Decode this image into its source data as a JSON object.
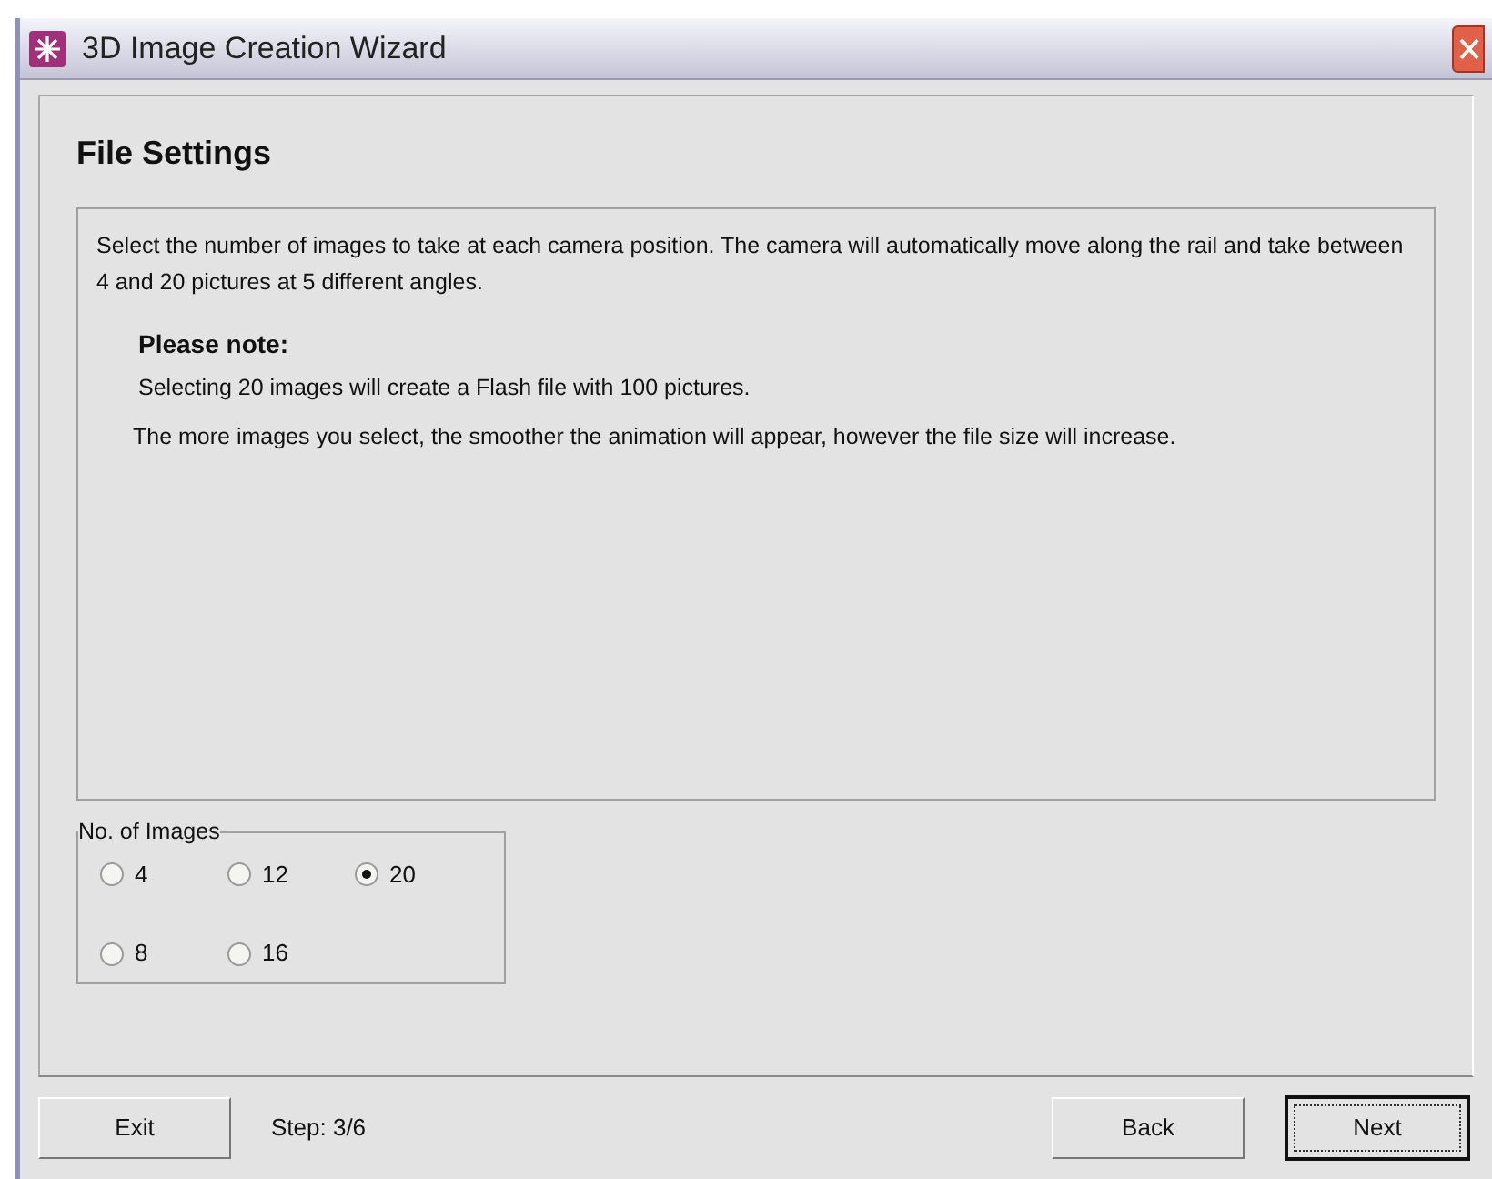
{
  "window": {
    "title": "3D Image Creation Wizard"
  },
  "heading": "File Settings",
  "description": "Select the number of images to take at each camera position. The camera will automatically move along the rail and take between 4 and 20 pictures at 5 different angles.",
  "note": {
    "title": "Please note:",
    "lines": [
      "Selecting 20 images will create a Flash file with 100 pictures.",
      "The more images you select, the smoother the animation will appear, however the file size will increase."
    ]
  },
  "images_group": {
    "label": "No. of Images",
    "options": [
      {
        "label": "4",
        "selected": false
      },
      {
        "label": "12",
        "selected": false
      },
      {
        "label": "20",
        "selected": true
      },
      {
        "label": "8",
        "selected": false
      },
      {
        "label": "16",
        "selected": false
      }
    ]
  },
  "buttons": {
    "exit": "Exit",
    "back": "Back",
    "next": "Next"
  },
  "step": "Step: 3/6"
}
